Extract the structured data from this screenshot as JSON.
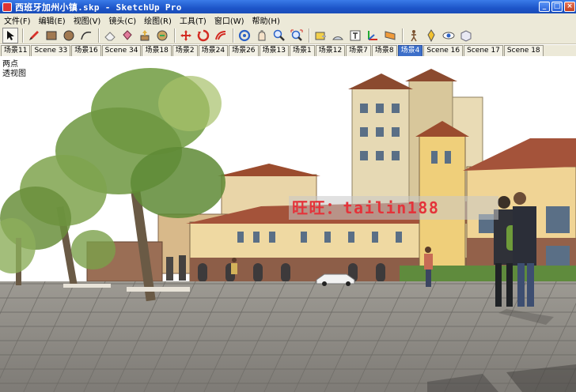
{
  "window": {
    "title": "西班牙加州小镇.skp - SketchUp Pro",
    "buttons": {
      "minimize": "_",
      "maximize": "□",
      "close": "×"
    }
  },
  "menu": [
    "文件(F)",
    "编辑(E)",
    "视图(V)",
    "镜头(C)",
    "绘图(R)",
    "工具(T)",
    "窗口(W)",
    "帮助(H)"
  ],
  "toolbar": {
    "tools": [
      "select-icon",
      "pencil-icon",
      "rectangle-icon",
      "circle-icon",
      "arc-icon",
      "eraser-icon",
      "paint-bucket-icon",
      "push-pull-icon",
      "follow-me-icon",
      "move-icon",
      "rotate-icon",
      "offset-icon",
      "orbit-icon",
      "pan-icon",
      "zoom-icon",
      "zoom-extents-icon",
      "tape-measure-icon",
      "protractor-icon",
      "text-icon",
      "axes-icon",
      "section-plane-icon",
      "walk-icon",
      "position-camera-icon",
      "look-around-icon",
      "styles-icon"
    ]
  },
  "scene_tabs": [
    "场景11",
    "Scene 33",
    "场景16",
    "Scene 34",
    "场景18",
    "场景2",
    "场景24",
    "场景26",
    "场景13",
    "场景1",
    "场景12",
    "场景7",
    "场景8",
    "场景4",
    "Scene 16",
    "Scene 17",
    "Scene 18"
  ],
  "selected_tab_index": 13,
  "viewport": {
    "label_line1": "两点",
    "label_line2": "透视图",
    "watermark": "旺旺：tailin188"
  },
  "colors": {
    "titlebar": "#1d55c9",
    "chrome": "#ece9d8",
    "selected_tab": "#3d6fc9",
    "watermark_text": "#e4333a"
  }
}
